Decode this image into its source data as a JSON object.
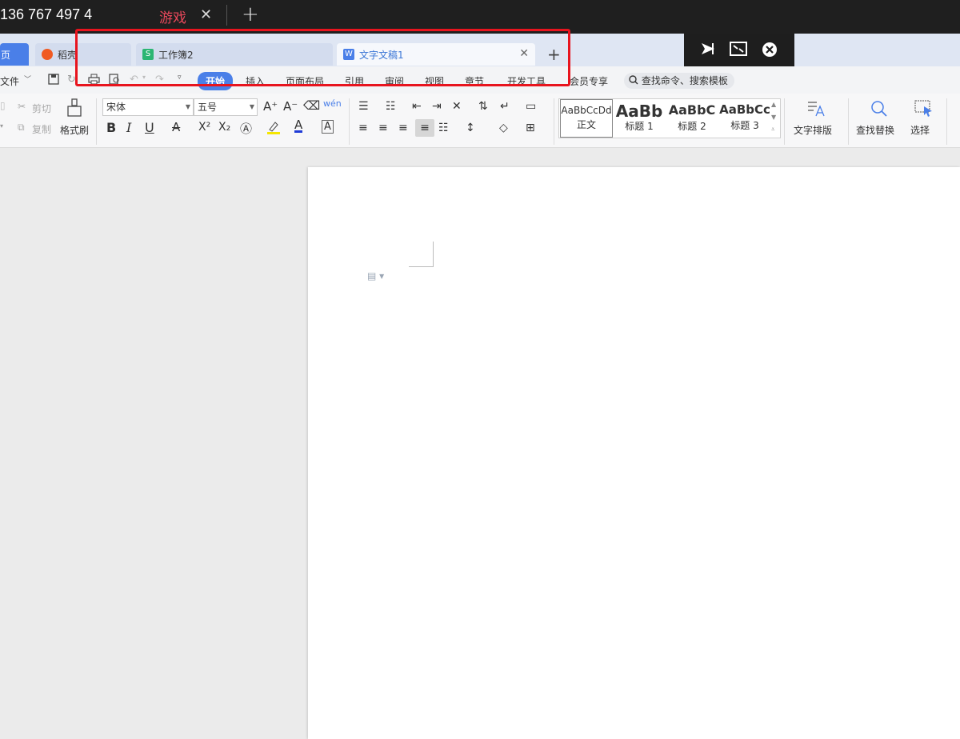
{
  "topbar": {
    "number": "136 767 497 4",
    "game_tab": "游戏",
    "close_glyph": "✕",
    "plus_glyph": "+"
  },
  "tabs": {
    "home": "页",
    "daoke": "稻壳",
    "workbook": "工作簿2",
    "document": "文字文稿1",
    "close_glyph": "✕",
    "add_glyph": "+"
  },
  "menu": {
    "file": "文件",
    "items": [
      "开始",
      "插入",
      "页面布局",
      "引用",
      "审阅",
      "视图",
      "章节",
      "开发工具",
      "会员专享"
    ],
    "search_placeholder": "查找命令、搜索模板"
  },
  "ribbon": {
    "cut": "剪切",
    "copy": "复制",
    "format_painter": "格式刷",
    "font_name": "宋体",
    "font_size": "五号",
    "styles": [
      {
        "preview": "AaBbCcDd",
        "label": "正文"
      },
      {
        "preview": "AaBb",
        "label": "标题 1"
      },
      {
        "preview": "AaBbC",
        "label": "标题 2"
      },
      {
        "preview": "AaBbCc",
        "label": "标题 3"
      }
    ],
    "text_layout": "文字排版",
    "find_replace": "查找替换",
    "select": "选择"
  },
  "icons": {
    "bold": "B",
    "italic": "I",
    "underline": "U",
    "font_color": "A",
    "superscript": "X²",
    "subscript": "X₂"
  },
  "colors": {
    "accent": "#4a7fe8",
    "highlight_box": "#e8141e",
    "game_tab": "#e8485b"
  }
}
